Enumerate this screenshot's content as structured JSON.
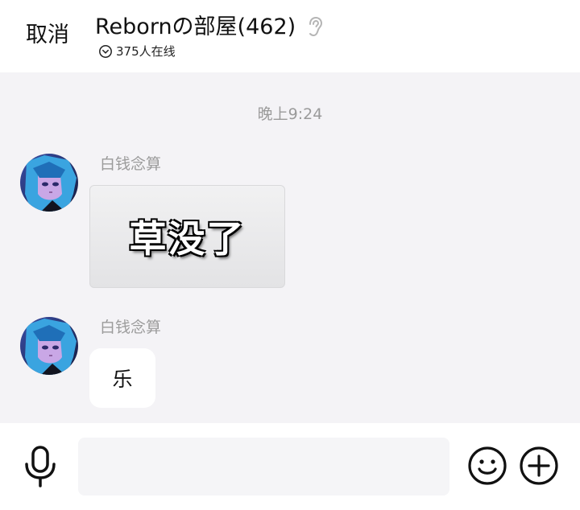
{
  "header": {
    "cancel_label": "取消",
    "title": "Rebornの部屋(462)",
    "online_text": "375人在线",
    "ear_icon": "ear-icon",
    "online_icon": "chevron-down-circle-icon"
  },
  "chat": {
    "timestamp": "晚上9:24",
    "messages": [
      {
        "sender": "白钱念算",
        "type": "sticker",
        "content": "草没了"
      },
      {
        "sender": "白钱念算",
        "type": "text",
        "content": "乐"
      }
    ]
  },
  "input_bar": {
    "placeholder": "",
    "voice_icon": "microphone-icon",
    "emoji_icon": "smiley-icon",
    "more_icon": "plus-circle-icon"
  },
  "colors": {
    "chat_background": "#f4f3f6",
    "meta_text": "#9b9b9b",
    "bubble": "#ffffff"
  }
}
